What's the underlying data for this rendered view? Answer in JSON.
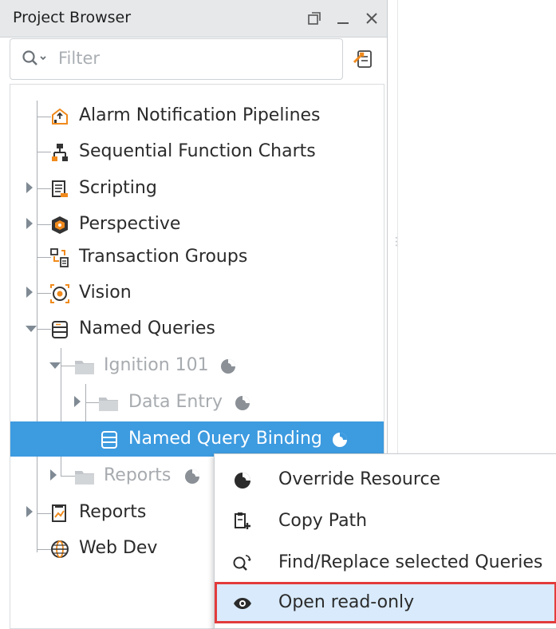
{
  "panel": {
    "title": "Project Browser",
    "filter_placeholder": "Filter"
  },
  "tree": [
    {
      "label": "Alarm Notification Pipelines",
      "icon": "alarm-pipeline-icon"
    },
    {
      "label": "Sequential Function Charts",
      "icon": "sfc-icon"
    },
    {
      "label": "Scripting",
      "icon": "scripting-icon"
    },
    {
      "label": "Perspective",
      "icon": "perspective-icon"
    },
    {
      "label": "Transaction Groups",
      "icon": "transaction-groups-icon"
    },
    {
      "label": "Vision",
      "icon": "vision-icon"
    },
    {
      "label": "Named Queries",
      "icon": "named-queries-icon"
    },
    {
      "label": "Ignition 101",
      "icon": "folder-icon"
    },
    {
      "label": "Data Entry",
      "icon": "folder-icon"
    },
    {
      "label": "Named Query Binding",
      "icon": "named-query-icon"
    },
    {
      "label": "Reports",
      "icon": "folder-icon"
    },
    {
      "label": "Reports",
      "icon": "reports-icon"
    },
    {
      "label": "Web Dev",
      "icon": "web-dev-icon"
    }
  ],
  "context_menu": {
    "items": [
      {
        "label": "Override Resource",
        "icon": "override-icon"
      },
      {
        "label": "Copy Path",
        "icon": "copy-path-icon"
      },
      {
        "label": "Find/Replace selected Queries",
        "icon": "find-replace-icon"
      },
      {
        "label": "Open read-only",
        "icon": "eye-icon"
      }
    ]
  },
  "colors": {
    "selection": "#3d9be0",
    "highlight_box": "#e23b3b",
    "menu_hover": "#d8eafb"
  }
}
